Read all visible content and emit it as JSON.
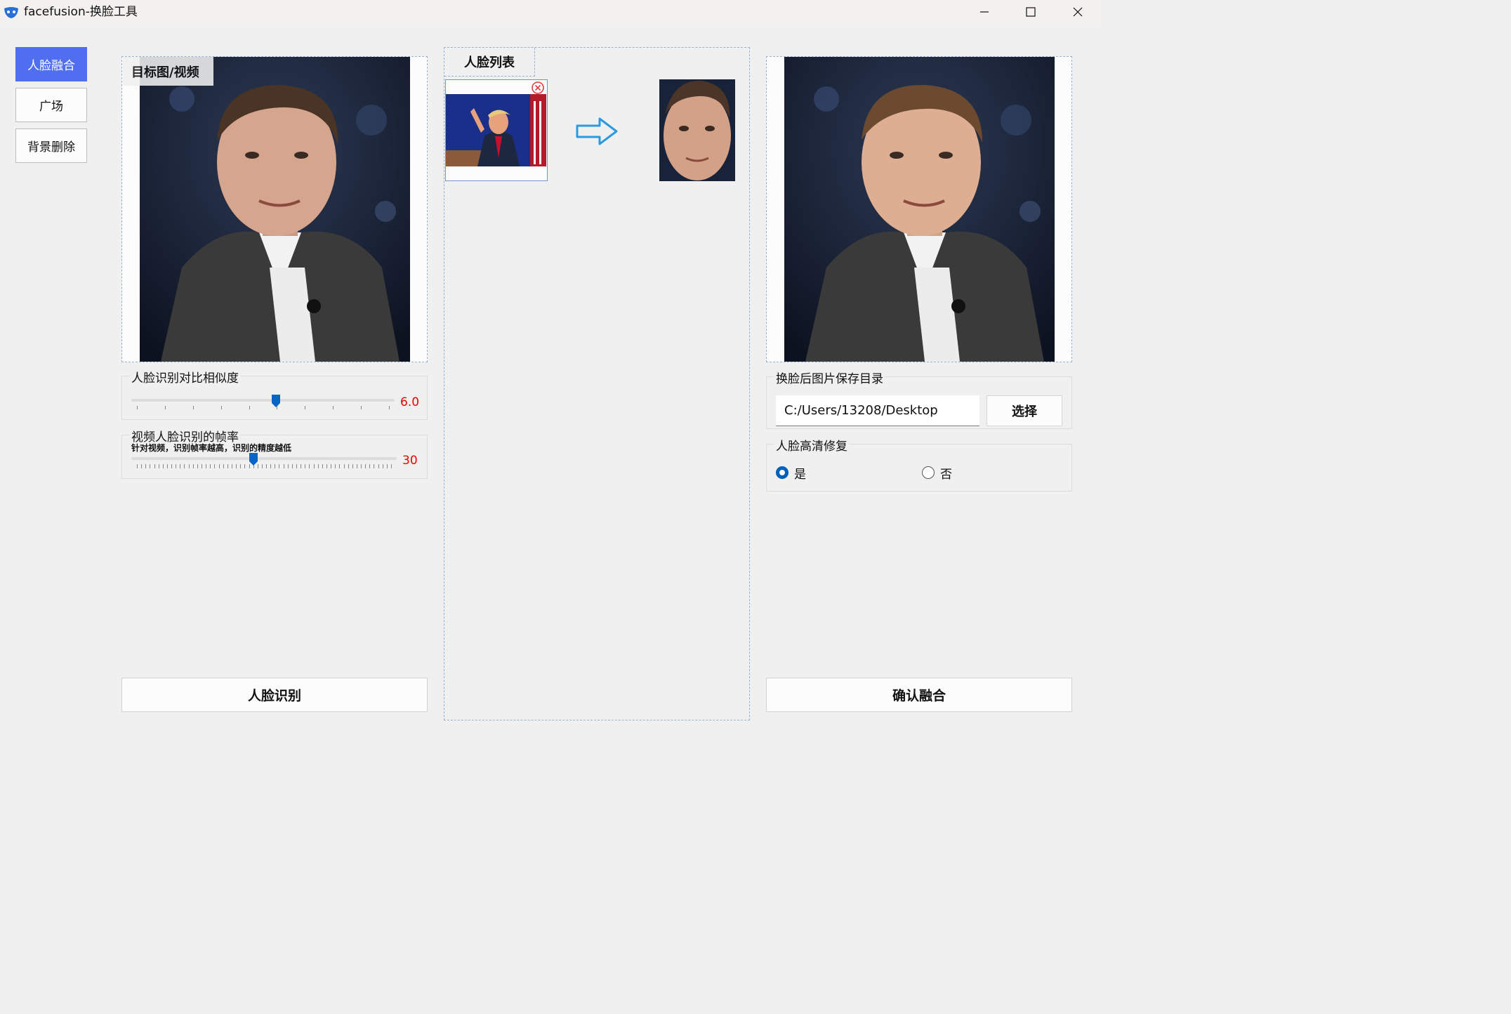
{
  "window": {
    "title": "facefusion-换脸工具"
  },
  "nav": {
    "items": [
      {
        "label": "人脸融合",
        "active": true
      },
      {
        "label": "广场",
        "active": false
      },
      {
        "label": "背景删除",
        "active": false
      }
    ]
  },
  "left": {
    "image_label": "目标图/视频",
    "similarity": {
      "title": "人脸识别对比相似度",
      "value": "6.0",
      "level": 0.55
    },
    "framerate": {
      "title": "视频人脸识别的帧率",
      "hint": "针对视频，识别帧率越高，识别的精度越低",
      "value": "30",
      "level": 0.46
    },
    "detect_button": "人脸识别"
  },
  "middle": {
    "title": "人脸列表"
  },
  "right": {
    "save_dir": {
      "title": "换脸后图片保存目录",
      "value": "C:/Users/13208/Desktop",
      "choose_button": "选择"
    },
    "hd_repair": {
      "title": "人脸高清修复",
      "options": [
        {
          "label": "是",
          "checked": true
        },
        {
          "label": "否",
          "checked": false
        }
      ]
    },
    "confirm_button": "确认融合"
  },
  "colors": {
    "accent": "#4f6ff0",
    "value_red": "#e00000",
    "slider_blue": "#0a64c8",
    "radio_blue": "#005fb8"
  }
}
